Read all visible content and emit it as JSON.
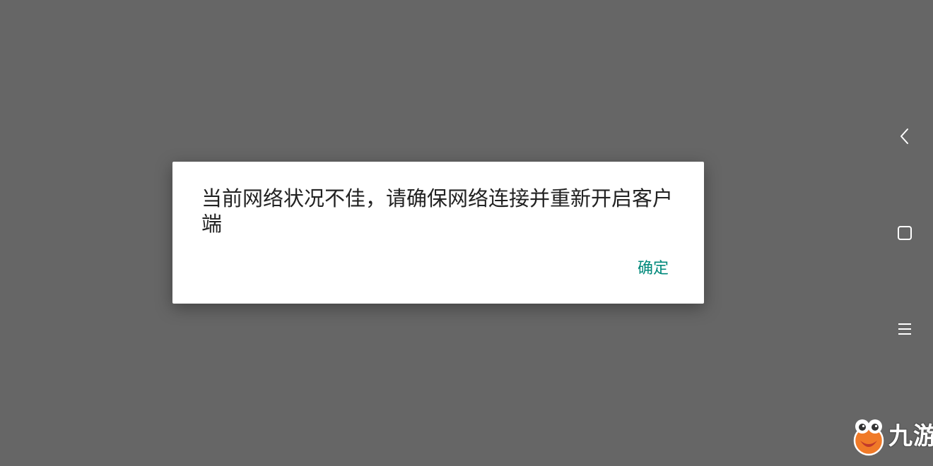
{
  "dialog": {
    "message": "当前网络状况不佳，请确保网络连接并重新开启客户端",
    "confirm_label": "确定"
  },
  "navbar": {
    "back_icon": "chevron-left-icon",
    "home_icon": "square-icon",
    "menu_icon": "hamburger-icon"
  },
  "watermark": {
    "text": "九游"
  },
  "colors": {
    "background": "#666666",
    "dialog_bg": "#ffffff",
    "message_text": "#222222",
    "accent": "#00897b",
    "nav_icon": "#ffffff",
    "logo_orange": "#f07a28"
  }
}
